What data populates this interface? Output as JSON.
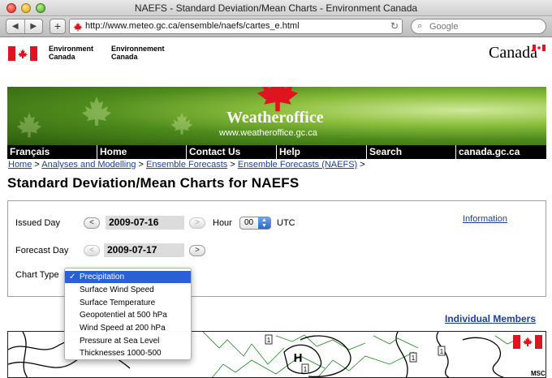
{
  "browser": {
    "window_title": "NAEFS - Standard Deviation/Mean Charts - Environment Canada",
    "nav_back": "◀",
    "nav_forward": "▶",
    "add_label": "+",
    "url": "http://www.meteo.gc.ca/ensemble/naefs/cartes_e.html",
    "refresh_glyph": "↻",
    "search_placeholder": "Google"
  },
  "header": {
    "dept_en_line1": "Environment",
    "dept_en_line2": "Canada",
    "dept_fr_line1": "Environnement",
    "dept_fr_line2": "Canada",
    "wordmark": "Canada"
  },
  "banner": {
    "title": "Weatheroffice",
    "url": "www.weatheroffice.gc.ca"
  },
  "menu": {
    "items": [
      "Français",
      "Home",
      "Contact Us",
      "Help",
      "Search",
      "canada.gc.ca"
    ]
  },
  "breadcrumb": {
    "links": [
      "Home",
      "Analyses and Modelling",
      "Ensemble Forecasts",
      "Ensemble Forecasts (NAEFS)"
    ],
    "separator": ">"
  },
  "page": {
    "title": "Standard Deviation/Mean Charts for NAEFS"
  },
  "form": {
    "issued_label": "Issued Day",
    "issued_date": "2009-07-16",
    "hour_label": "Hour",
    "hour_value": "00",
    "utc_label": "UTC",
    "forecast_label": "Forecast Day",
    "forecast_date": "2009-07-17",
    "chart_type_label": "Chart Type",
    "prev_glyph": "<",
    "next_glyph": ">",
    "information_link": "Information"
  },
  "dropdown": {
    "checkmark": "✓",
    "options": [
      "Precipitation",
      "Surface Wind Speed",
      "Surface Temperature",
      "Geopotentiel at 500 hPa",
      "Wind Speed at 200 hPa",
      "Pressure at Sea Level",
      "Thicknesses 1000-500"
    ],
    "selected": "Precipitation"
  },
  "links": {
    "individual_members": "Individual Members"
  },
  "map": {
    "labels": [
      "1",
      "1",
      "H",
      "1",
      "1"
    ],
    "msc": "MSC"
  },
  "colors": {
    "canada_red": "#e0141e",
    "link_blue": "#1a3fa0",
    "menu_black": "#000000",
    "selection_blue": "#2a5fd6"
  }
}
